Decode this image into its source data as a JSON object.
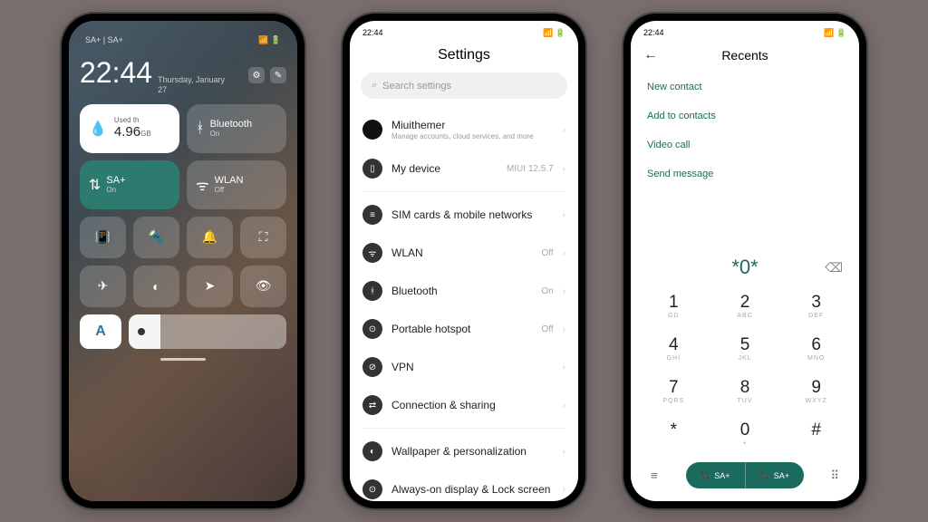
{
  "p1": {
    "status_left": "SA+ | SA+",
    "time": "22:44",
    "date_line1": "Thursday, January",
    "date_line2": "27",
    "data_tile": {
      "used_label": "Used th",
      "amount": "4.96",
      "unit": "GB"
    },
    "bluetooth": {
      "label": "Bluetooth",
      "state": "On"
    },
    "sa": {
      "label": "SA+",
      "state": "On"
    },
    "wlan": {
      "label": "WLAN",
      "state": "Off"
    },
    "auto": "A"
  },
  "p2": {
    "status_time": "22:44",
    "title": "Settings",
    "search_placeholder": "Search settings",
    "account": {
      "name": "Miuithemer",
      "sub": "Manage accounts, cloud services, and more"
    },
    "device": {
      "label": "My device",
      "value": "MIUI 12.5.7"
    },
    "rows": [
      {
        "label": "SIM cards & mobile networks",
        "value": ""
      },
      {
        "label": "WLAN",
        "value": "Off"
      },
      {
        "label": "Bluetooth",
        "value": "On"
      },
      {
        "label": "Portable hotspot",
        "value": "Off"
      },
      {
        "label": "VPN",
        "value": ""
      },
      {
        "label": "Connection & sharing",
        "value": ""
      }
    ],
    "rows2": [
      {
        "label": "Wallpaper & personalization"
      },
      {
        "label": "Always-on display & Lock screen"
      }
    ]
  },
  "p3": {
    "status_time": "22:44",
    "title": "Recents",
    "options": [
      "New contact",
      "Add to contacts",
      "Video call",
      "Send message"
    ],
    "number": "*0*",
    "keys": [
      {
        "n": "1",
        "l": "GD"
      },
      {
        "n": "2",
        "l": "ABC"
      },
      {
        "n": "3",
        "l": "DEF"
      },
      {
        "n": "4",
        "l": "GHI"
      },
      {
        "n": "5",
        "l": "JKL"
      },
      {
        "n": "6",
        "l": "MNO"
      },
      {
        "n": "7",
        "l": "PQRS"
      },
      {
        "n": "8",
        "l": "TUV"
      },
      {
        "n": "9",
        "l": "WXYZ"
      },
      {
        "n": "*",
        "l": ""
      },
      {
        "n": "0",
        "l": "+"
      },
      {
        "n": "#",
        "l": ""
      }
    ],
    "call_labels": [
      "SA+",
      "SA+"
    ]
  }
}
